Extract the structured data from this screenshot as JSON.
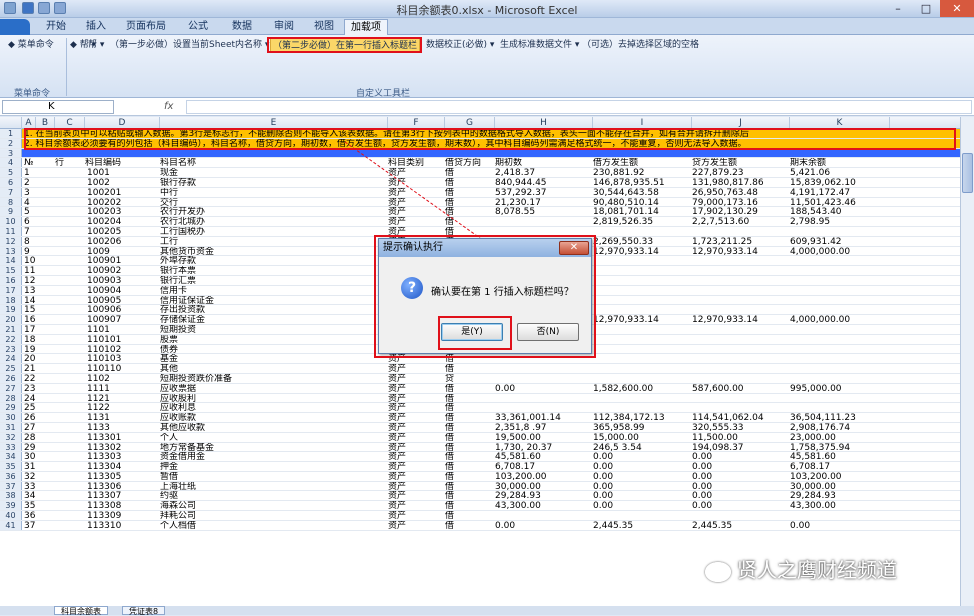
{
  "window": {
    "title": "科目余额表0.xlsx - Microsoft Excel",
    "min": "–",
    "max": "□",
    "close": "✕"
  },
  "tabs": [
    "开始",
    "插入",
    "页面布局",
    "公式",
    "数据",
    "审阅",
    "视图",
    "加载项"
  ],
  "ribbon": {
    "left_label": "◆ 菜单命令",
    "left_group": "菜单命令",
    "items": [
      "◆ 帮 ▾",
      "帮 ▾",
      "（第一步必做）设置当前Sheet内名称 ▾",
      "（第二步必做）在第一行插入标题栏",
      "数据校正(必做) ▾",
      "生成标准数据文件 ▾",
      "（可选）去掉选择区域的空格"
    ],
    "group_label": "自定义工具栏"
  },
  "formula": {
    "namebox": "K",
    "fx": "fx",
    "value": ""
  },
  "columns": [
    "A",
    "B",
    "C",
    "D",
    "E",
    "F",
    "G",
    "H",
    "I",
    "J",
    "K"
  ],
  "banner": {
    "row1": "1. 在当前表页中可以粘贴或输入数据。第3行是标志行，不能删除否则不能导入该表数据。请在第3行下按列表中的数据格式导入数据，表头一面不能存在合并，如有合并请拆开删除后",
    "row2": "2. 科目余额表必须要有的列包括（科目编码），科目名称，借贷方向，期初数，借方发生额，贷方发生额，期末数），其中科目编码列需满足格式统一，不能重复，否则无法导入数据。"
  },
  "headers": [
    "№",
    "行",
    "科目编码",
    "科目名称",
    "科目类别",
    "借贷方向",
    "期初数",
    "借方发生额",
    "贷方发生额",
    "期末余额"
  ],
  "rows": [
    {
      "n": "5",
      "a": "1",
      "c": "1001",
      "d": "现金",
      "e": "资产",
      "f": "借",
      "g": "2,418.37",
      "h": "230,881.92",
      "i": "227,879.23",
      "j": "5,421.06"
    },
    {
      "n": "6",
      "a": "2",
      "c": "1002",
      "d": "银行存款",
      "e": "资产",
      "f": "借",
      "g": "840,944.45",
      "h": "146,878,935.51",
      "i": "131,980,817.86",
      "j": "15,839,062.10"
    },
    {
      "n": "7",
      "a": "3",
      "c": "100201",
      "d": "中行",
      "e": "资产",
      "f": "借",
      "g": "537,292.37",
      "h": "30,544,643.58",
      "i": "26,950,763.48",
      "j": "4,191,172.47"
    },
    {
      "n": "8",
      "a": "4",
      "c": "100202",
      "d": "交行",
      "e": "资产",
      "f": "借",
      "g": "21,230.17",
      "h": "90,480,510.14",
      "i": "79,000,173.16",
      "j": "11,501,423.46"
    },
    {
      "n": "9",
      "a": "5",
      "c": "100203",
      "d": "农行开发办",
      "e": "资产",
      "f": "借",
      "g": "8,078.55",
      "h": "18,081,701.14",
      "i": "17,902,130.29",
      "j": "188,543.40"
    },
    {
      "n": "10",
      "a": "6",
      "c": "100204",
      "d": "农行北城办",
      "e": "资产",
      "f": "借",
      "g": "",
      "h": "2,819,526.35",
      "i": "2,2,7,513.60",
      "j": "2,798.95"
    },
    {
      "n": "11",
      "a": "7",
      "c": "100205",
      "d": "工行国税办",
      "e": "资产",
      "f": "借",
      "g": "",
      "h": "",
      "i": "",
      "j": ""
    },
    {
      "n": "12",
      "a": "8",
      "c": "100206",
      "d": "工行",
      "e": "资产",
      "f": "借",
      "g": "",
      "h": "2,269,550.33",
      "i": "1,723,211.25",
      "j": "609,931.42"
    },
    {
      "n": "13",
      "a": "9",
      "c": "1009",
      "d": "其他货币资金",
      "e": "资产",
      "f": "借",
      "g": "",
      "h": "12,970,933.14",
      "i": "12,970,933.14",
      "j": "4,000,000.00"
    },
    {
      "n": "14",
      "a": "10",
      "c": "100901",
      "d": "外埠存款",
      "e": "资产",
      "f": "借",
      "g": "",
      "h": "",
      "i": "",
      "j": ""
    },
    {
      "n": "15",
      "a": "11",
      "c": "100902",
      "d": "银行本票",
      "e": "资产",
      "f": "借",
      "g": "",
      "h": "",
      "i": "",
      "j": ""
    },
    {
      "n": "16",
      "a": "12",
      "c": "100903",
      "d": "银行汇票",
      "e": "资产",
      "f": "借",
      "g": "",
      "h": "",
      "i": "",
      "j": ""
    },
    {
      "n": "17",
      "a": "13",
      "c": "100904",
      "d": "信用卡",
      "e": "资产",
      "f": "借",
      "g": "",
      "h": "",
      "i": "",
      "j": ""
    },
    {
      "n": "18",
      "a": "14",
      "c": "100905",
      "d": "信用证保证金",
      "e": "资产",
      "f": "借",
      "g": "",
      "h": "",
      "i": "",
      "j": ""
    },
    {
      "n": "19",
      "a": "15",
      "c": "100906",
      "d": "存出投资款",
      "e": "资产",
      "f": "借",
      "g": "",
      "h": "",
      "i": "",
      "j": ""
    },
    {
      "n": "20",
      "a": "16",
      "c": "100907",
      "d": "存储保证金",
      "e": "资产",
      "f": "借",
      "g": "4,000,000.00",
      "h": "12,970,933.14",
      "i": "12,970,933.14",
      "j": "4,000,000.00"
    },
    {
      "n": "21",
      "a": "17",
      "c": "1101",
      "d": "短期投资",
      "e": "资产",
      "f": "借",
      "g": "",
      "h": "",
      "i": "",
      "j": ""
    },
    {
      "n": "22",
      "a": "18",
      "c": "110101",
      "d": "股票",
      "e": "资产",
      "f": "借",
      "g": "",
      "h": "",
      "i": "",
      "j": ""
    },
    {
      "n": "23",
      "a": "19",
      "c": "110102",
      "d": "债券",
      "e": "资产",
      "f": "借",
      "g": "",
      "h": "",
      "i": "",
      "j": ""
    },
    {
      "n": "24",
      "a": "20",
      "c": "110103",
      "d": "基金",
      "e": "资产",
      "f": "借",
      "g": "",
      "h": "",
      "i": "",
      "j": ""
    },
    {
      "n": "25",
      "a": "21",
      "c": "110110",
      "d": "其他",
      "e": "资产",
      "f": "借",
      "g": "",
      "h": "",
      "i": "",
      "j": ""
    },
    {
      "n": "26",
      "a": "22",
      "c": "1102",
      "d": "短期投资跌价准备",
      "e": "资产",
      "f": "贷",
      "g": "",
      "h": "",
      "i": "",
      "j": ""
    },
    {
      "n": "27",
      "a": "23",
      "c": "1111",
      "d": "应收票据",
      "e": "资产",
      "f": "借",
      "g": "0.00",
      "h": "1,582,600.00",
      "i": "587,600.00",
      "j": "995,000.00"
    },
    {
      "n": "28",
      "a": "24",
      "c": "1121",
      "d": "应收股利",
      "e": "资产",
      "f": "借",
      "g": "",
      "h": "",
      "i": "",
      "j": ""
    },
    {
      "n": "29",
      "a": "25",
      "c": "1122",
      "d": "应收利息",
      "e": "资产",
      "f": "借",
      "g": "",
      "h": "",
      "i": "",
      "j": ""
    },
    {
      "n": "30",
      "a": "26",
      "c": "1131",
      "d": "应收账款",
      "e": "资产",
      "f": "借",
      "g": "33,361,001.14",
      "h": "112,384,172.13",
      "i": "114,541,062.04",
      "j": "36,504,111.23"
    },
    {
      "n": "31",
      "a": "27",
      "c": "1133",
      "d": "其他应收款",
      "e": "资产",
      "f": "借",
      "g": "2,351,8 .97",
      "h": "365,958.99",
      "i": "320,555.33",
      "j": "2,908,176.74"
    },
    {
      "n": "32",
      "a": "28",
      "c": "113301",
      "d": "个人",
      "e": "资产",
      "f": "借",
      "g": "19,500.00",
      "h": "15,000.00",
      "i": "11,500.00",
      "j": "23,000.00"
    },
    {
      "n": "33",
      "a": "29",
      "c": "113302",
      "d": "地方常备基金",
      "e": "资产",
      "f": "借",
      "g": "1,730, 20.37",
      "h": "246,5 3.54",
      "i": "194,098.37",
      "j": "1,758,375.94"
    },
    {
      "n": "34",
      "a": "30",
      "c": "113303",
      "d": "资金借用金",
      "e": "资产",
      "f": "借",
      "g": "45,581.60",
      "h": "0.00",
      "i": "0.00",
      "j": "45,581.60"
    },
    {
      "n": "35",
      "a": "31",
      "c": "113304",
      "d": "押金",
      "e": "资产",
      "f": "借",
      "g": "6,708.17",
      "h": "0.00",
      "i": "0.00",
      "j": "6,708.17"
    },
    {
      "n": "36",
      "a": "32",
      "c": "113305",
      "d": "暂借",
      "e": "资产",
      "f": "借",
      "g": "103,200.00",
      "h": "0.00",
      "i": "0.00",
      "j": "103,200.00"
    },
    {
      "n": "37",
      "a": "33",
      "c": "113306",
      "d": "上海壮纸",
      "e": "资产",
      "f": "借",
      "g": "30,000.00",
      "h": "0.00",
      "i": "0.00",
      "j": "30,000.00"
    },
    {
      "n": "38",
      "a": "34",
      "c": "113307",
      "d": "约驱",
      "e": "资产",
      "f": "借",
      "g": "29,284.93",
      "h": "0.00",
      "i": "0.00",
      "j": "29,284.93"
    },
    {
      "n": "39",
      "a": "35",
      "c": "113308",
      "d": "海森公司",
      "e": "资产",
      "f": "借",
      "g": "43,300.00",
      "h": "0.00",
      "i": "0.00",
      "j": "43,300.00"
    },
    {
      "n": "40",
      "a": "36",
      "c": "113309",
      "d": "拜耗公司",
      "e": "资产",
      "f": "借",
      "g": "",
      "h": "",
      "i": "",
      "j": ""
    },
    {
      "n": "41",
      "a": "37",
      "c": "113310",
      "d": "个人档借",
      "e": "资产",
      "f": "借",
      "g": "0.00",
      "h": "2,445.35",
      "i": "2,445.35",
      "j": "0.00"
    }
  ],
  "sheet_tabs": [
    "科目余额表",
    "凭证表8"
  ],
  "dialog": {
    "title": "提示确认执行",
    "close": "✕",
    "icon": "?",
    "message": "确认要在第 1 行插入标题栏吗？",
    "yes": "是(Y)",
    "no": "否(N)"
  },
  "watermark": "贤人之鹰财经频道",
  "colors": {
    "banner": "#ffc000",
    "highlight": "#3366ff",
    "annotation": "#e0101a"
  }
}
